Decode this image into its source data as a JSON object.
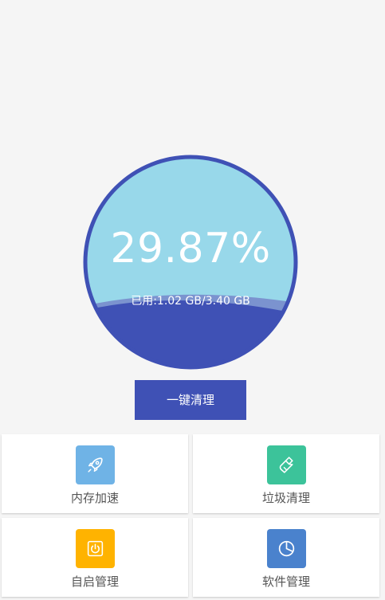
{
  "colors": {
    "accent": "#3f51b5",
    "gauge_fill": "#98d8ea",
    "tile_memory": "#6fb3e6",
    "tile_trash": "#3cc39a",
    "tile_startup": "#ffb300",
    "tile_software": "#4a82cd"
  },
  "gauge": {
    "percent_text": "29.87%",
    "usage_text": "已用:1.02 GB/3.40 GB",
    "used_fraction": 0.2987
  },
  "clean_button": {
    "label": "一键清理"
  },
  "tiles": [
    {
      "label": "内存加速",
      "icon": "rocket-icon"
    },
    {
      "label": "垃圾清理",
      "icon": "broom-icon"
    },
    {
      "label": "自启管理",
      "icon": "power-icon"
    },
    {
      "label": "软件管理",
      "icon": "pie-chart-icon"
    }
  ]
}
